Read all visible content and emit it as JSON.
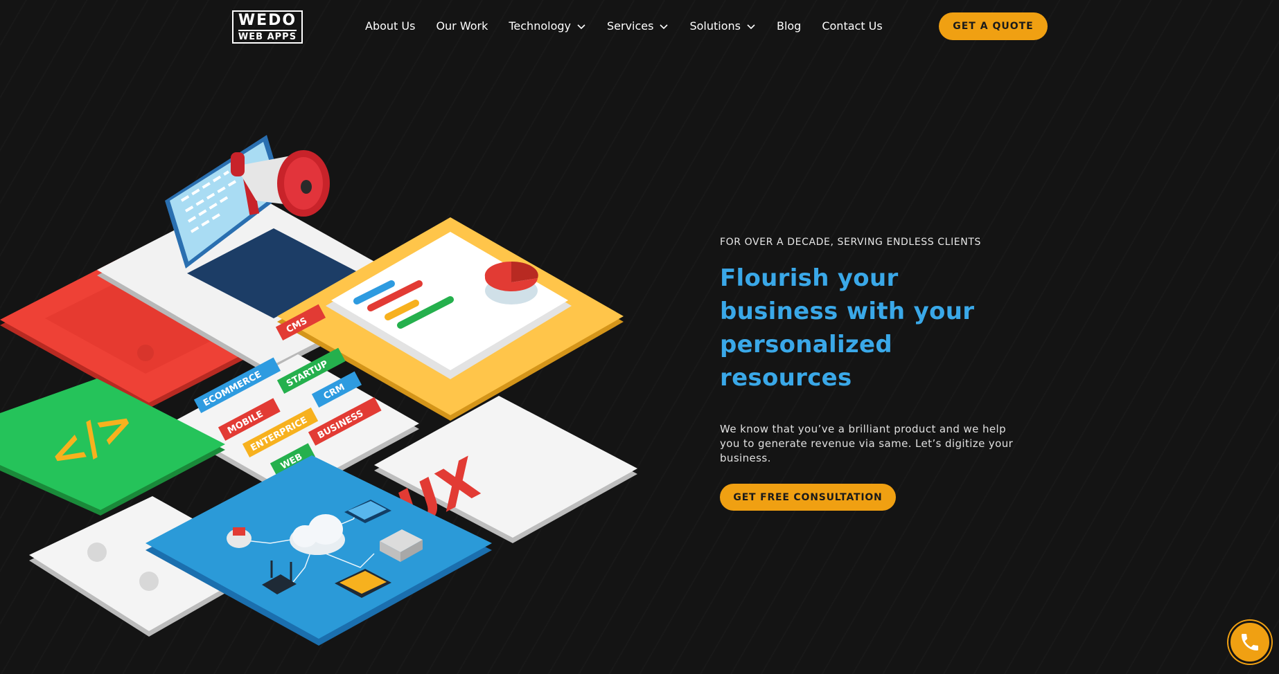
{
  "header": {
    "logo_line1": "WEDO",
    "logo_line2": "WEB APPS",
    "nav": [
      {
        "label": "About Us",
        "dropdown": false
      },
      {
        "label": "Our Work",
        "dropdown": false
      },
      {
        "label": "Technology",
        "dropdown": true
      },
      {
        "label": "Services",
        "dropdown": true
      },
      {
        "label": "Solutions",
        "dropdown": true
      },
      {
        "label": "Blog",
        "dropdown": false
      },
      {
        "label": "Contact Us",
        "dropdown": false
      }
    ],
    "quote_label": "GET A QUOTE"
  },
  "hero": {
    "eyebrow": "FOR OVER A DECADE, SERVING ENDLESS CLIENTS",
    "headline": "Flourish your business with your personalized resources",
    "lead": "We know that you’ve a brilliant product and we help you to generate revenue via same. Let’s digitize your business.",
    "cta_label": "GET FREE CONSULTATION"
  },
  "illustration": {
    "tags": [
      "CMS",
      "ECOMMERCE",
      "STARTUP",
      "CRM",
      "MOBILE",
      "ENTERPRICE",
      "BUSINESS",
      "WEB"
    ],
    "ux_label": "UX",
    "code_label": "</>"
  },
  "colors": {
    "accent": "#f0a012",
    "headline": "#3aa8e8",
    "background": "#141414"
  },
  "icons": [
    "chevron-down-icon",
    "phone-icon"
  ]
}
